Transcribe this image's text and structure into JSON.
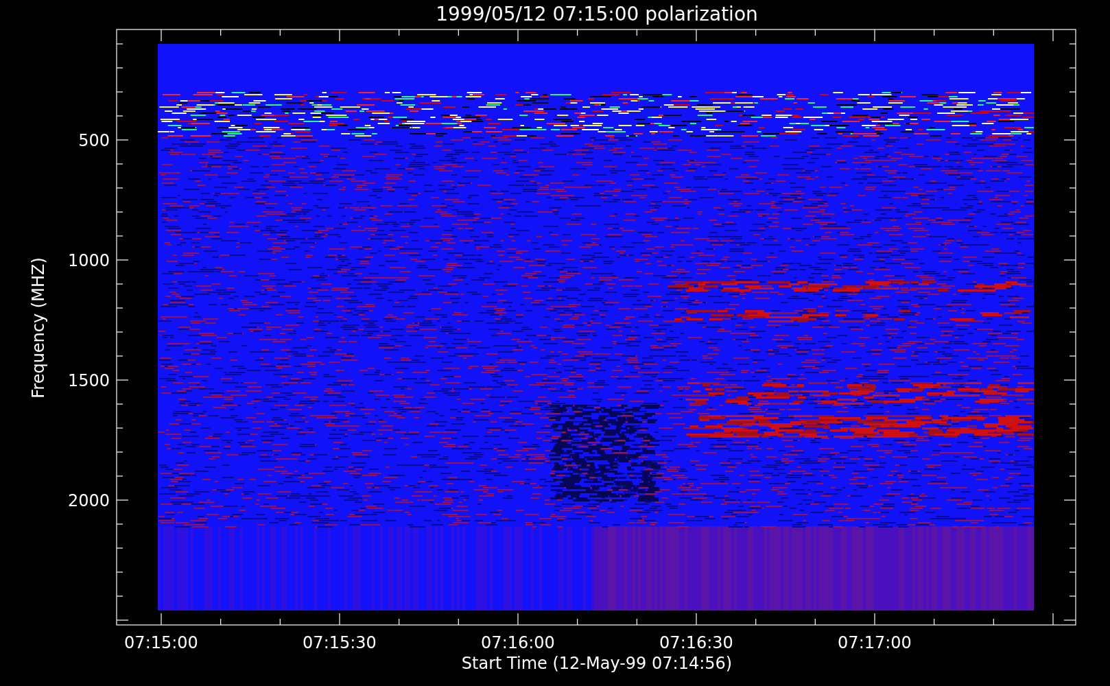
{
  "title": "1999/05/12 07:15:00 polarization",
  "y_axis": {
    "label": "Frequency (MHZ)",
    "ticks": [
      "500",
      "1000",
      "1500",
      "2000"
    ]
  },
  "x_axis": {
    "label": "Start Time (12-May-99 07:14:56)",
    "ticks": [
      "07:15:00",
      "07:15:30",
      "07:16:00",
      "07:16:30",
      "07:17:00"
    ]
  }
}
